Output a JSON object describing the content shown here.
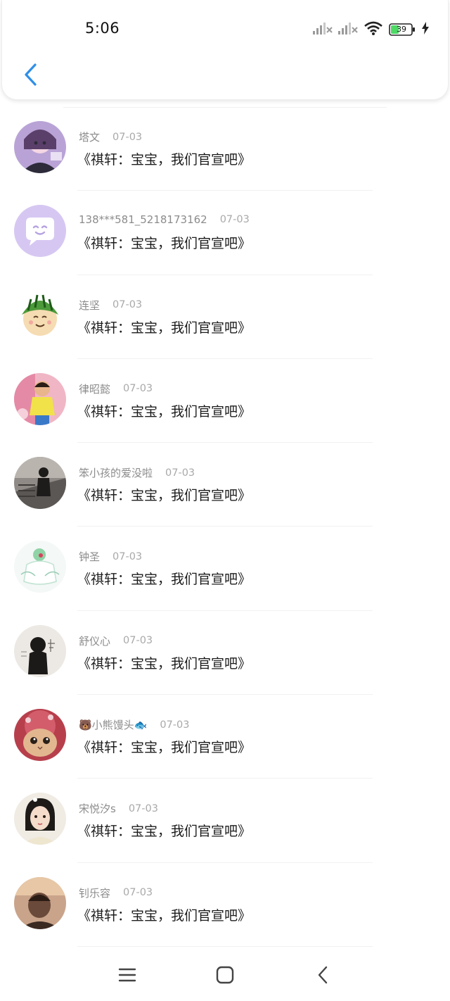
{
  "status_bar": {
    "time": "5:06",
    "battery_level": "39",
    "icons": [
      "signal-icon",
      "signal-icon",
      "wifi-icon",
      "battery-icon",
      "charging-icon"
    ]
  },
  "header": {
    "back_icon": "chevron-left-icon"
  },
  "comments": [
    {
      "user": "塔文",
      "date": "07-03",
      "text": "《祺轩：宝宝，我们官宣吧》",
      "avatar_color": "#c9a9d8"
    },
    {
      "user": "138***581_5218173162",
      "date": "07-03",
      "text": "《祺轩：宝宝，我们官宣吧》",
      "avatar_color": "#d6c7f2"
    },
    {
      "user": "连坚",
      "date": "07-03",
      "text": "《祺轩：宝宝，我们官宣吧》",
      "avatar_color": "#f6edd9"
    },
    {
      "user": "律昭懿",
      "date": "07-03",
      "text": "《祺轩：宝宝，我们官宣吧》",
      "avatar_color": "#e8a8b9"
    },
    {
      "user": "笨小孩的爱没啦",
      "date": "07-03",
      "text": "《祺轩：宝宝，我们官宣吧》",
      "avatar_color": "#6e6a66"
    },
    {
      "user": "钟圣",
      "date": "07-03",
      "text": "《祺轩：宝宝，我们官宣吧》",
      "avatar_color": "#e9f1ee"
    },
    {
      "user": "舒仪心",
      "date": "07-03",
      "text": "《祺轩：宝宝，我们官宣吧》",
      "avatar_color": "#e9e6e1"
    },
    {
      "user": "🐻小熊馒头🐟",
      "date": "07-03",
      "text": "《祺轩：宝宝，我们官宣吧》",
      "avatar_color": "#c8505d"
    },
    {
      "user": "宋悦汐s",
      "date": "07-03",
      "text": "《祺轩：宝宝，我们官宣吧》",
      "avatar_color": "#ece6dc"
    },
    {
      "user": "钊乐容",
      "date": "07-03",
      "text": "《祺轩：宝宝，我们官宣吧》",
      "avatar_color": "#8a6a55"
    }
  ],
  "nav": {
    "menu_icon": "menu-icon",
    "home_icon": "home-icon",
    "back_icon": "back-icon"
  },
  "colors": {
    "accent": "#2e8fe8",
    "battery_fill": "#4cd964"
  }
}
